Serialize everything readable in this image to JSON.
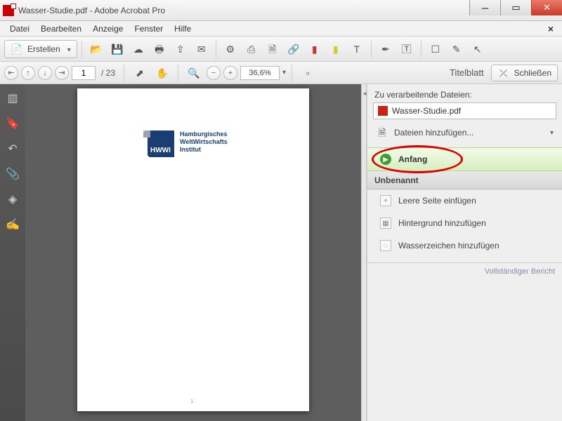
{
  "window": {
    "title": "Wasser-Studie.pdf - Adobe Acrobat Pro"
  },
  "menubar": {
    "items": [
      "Datei",
      "Bearbeiten",
      "Anzeige",
      "Fenster",
      "Hilfe"
    ]
  },
  "toolbar": {
    "create_label": "Erstellen"
  },
  "nav": {
    "page_current": "1",
    "page_total": "/ 23",
    "zoom": "36,6%"
  },
  "navright": {
    "action_title": "Titelblatt",
    "close_label": "Schließen"
  },
  "document": {
    "logo_abbr": "HWWI",
    "logo_line1": "Hamburgisches",
    "logo_line2": "WeltWirtschafts",
    "logo_line3": "Institut",
    "page_number": "1"
  },
  "panel": {
    "files_label": "Zu verarbeitende Dateien:",
    "filename": "Wasser-Studie.pdf",
    "add_files": "Dateien hinzufügen...",
    "start": "Anfang",
    "section": "Unbenannt",
    "actions": {
      "insert_blank": "Leere Seite einfügen",
      "add_background": "Hintergrund hinzufügen",
      "add_watermark": "Wasserzeichen hinzufügen"
    },
    "footer": "Vollständiger Bericht"
  }
}
